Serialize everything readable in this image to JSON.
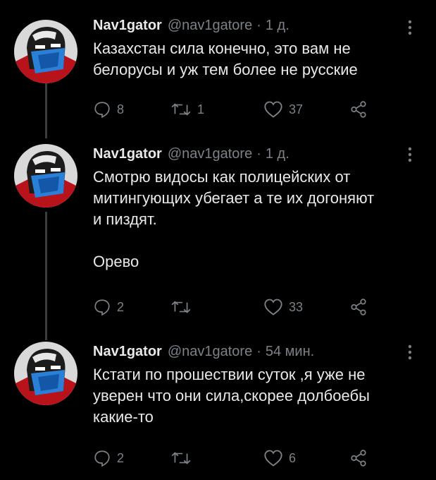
{
  "tweets": [
    {
      "name": "Nav1gator",
      "handle": "@nav1gatore",
      "separator": "·",
      "time": "1 д.",
      "text": "Казахстан сила конечно, это вам не\nбелорусы и уж тем более не русские",
      "replies": "8",
      "retweets": "1",
      "likes": "37",
      "share": ""
    },
    {
      "name": "Nav1gator",
      "handle": "@nav1gatore",
      "separator": "·",
      "time": "1 д.",
      "text": "Смотрю видосы как полицейских от\nмитингующих убегает а те их догоняют\nи пиздят.\n\nОрево",
      "replies": "2",
      "retweets": "",
      "likes": "33",
      "share": ""
    },
    {
      "name": "Nav1gator",
      "handle": "@nav1gatore",
      "separator": "·",
      "time": "54 мин.",
      "text": "Кстати по прошествии суток ,я уже не\nуверен что они сила,скорее долбоебы\nкакие-то",
      "replies": "2",
      "retweets": "",
      "likes": "6",
      "share": ""
    }
  ],
  "icons": {
    "reply": "reply-icon",
    "retweet": "retweet-icon",
    "like": "heart-icon",
    "share": "share-icon",
    "more": "more-icon"
  },
  "colors": {
    "background": "#000000",
    "text": "#e7e9ea",
    "secondary": "#7b8187",
    "thread_line": "#3a3d40"
  }
}
